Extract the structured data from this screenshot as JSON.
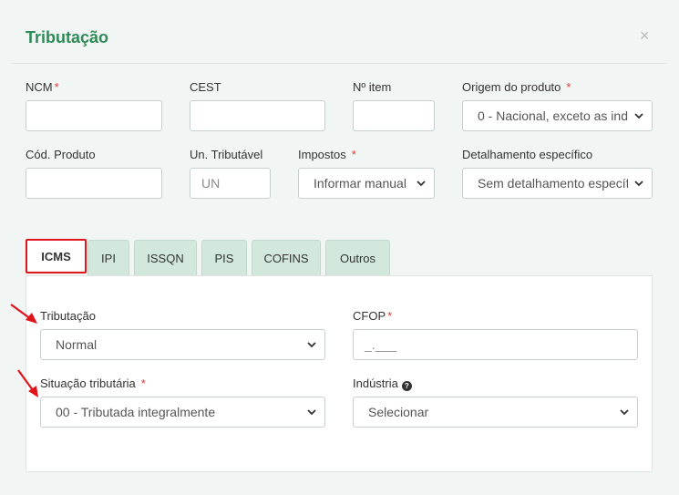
{
  "modal": {
    "title": "Tributação",
    "close_glyph": "×"
  },
  "fields": {
    "ncm": {
      "label": "NCM",
      "value": ""
    },
    "cest": {
      "label": "CEST",
      "value": ""
    },
    "n_item": {
      "label": "Nº item",
      "value": ""
    },
    "origem": {
      "label": "Origem do produto",
      "value": "0 - Nacional, exceto as ind"
    },
    "cod_produto": {
      "label": "Cód. Produto",
      "value": ""
    },
    "un_tributavel": {
      "label": "Un. Tributável",
      "placeholder": "UN"
    },
    "impostos": {
      "label": "Impostos",
      "value": "Informar manual"
    },
    "detalhamento": {
      "label": "Detalhamento específico",
      "value": "Sem detalhamento específi"
    }
  },
  "required_marker": "*",
  "tabs": [
    {
      "label": "ICMS",
      "active": true
    },
    {
      "label": "IPI"
    },
    {
      "label": "ISSQN"
    },
    {
      "label": "PIS"
    },
    {
      "label": "COFINS"
    },
    {
      "label": "Outros"
    }
  ],
  "icms": {
    "tributacao": {
      "label": "Tributação",
      "value": "Normal"
    },
    "cfop": {
      "label": "CFOP",
      "placeholder": "_.___"
    },
    "situacao": {
      "label": "Situação tributária",
      "value": "00 - Tributada integralmente"
    },
    "industria": {
      "label": "Indústria",
      "value": "Selecionar",
      "help_icon": "question-circle-icon"
    }
  },
  "colors": {
    "accent": "#2e8b57",
    "tab_bg": "#d2e8dd",
    "active_tab_border": "#e0151b",
    "annotation_arrow": "#e0151b",
    "required": "#e23a3a"
  }
}
